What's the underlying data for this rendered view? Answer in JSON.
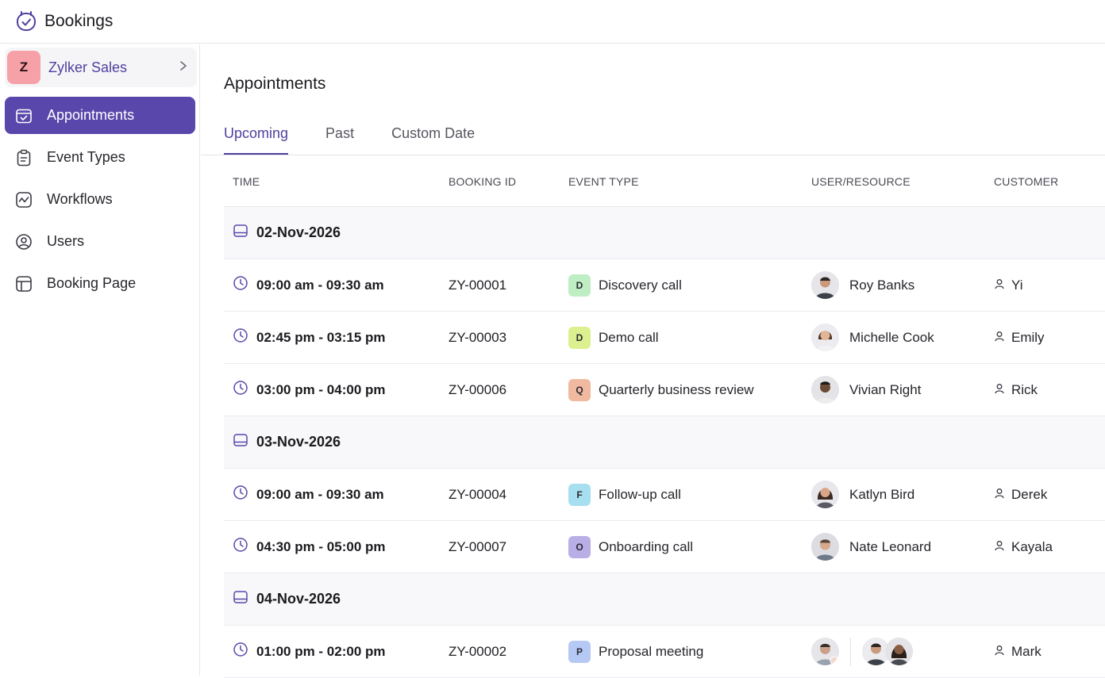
{
  "app": {
    "title": "Bookings"
  },
  "sidebar": {
    "workspace": {
      "initial": "Z",
      "name": "Zylker Sales"
    },
    "items": [
      {
        "label": "Appointments",
        "icon": "calendar-check-icon",
        "active": true
      },
      {
        "label": "Event Types",
        "icon": "clipboard-icon",
        "active": false
      },
      {
        "label": "Workflows",
        "icon": "workflow-icon",
        "active": false
      },
      {
        "label": "Users",
        "icon": "user-circle-icon",
        "active": false
      },
      {
        "label": "Booking Page",
        "icon": "layout-icon",
        "active": false
      }
    ]
  },
  "main": {
    "title": "Appointments",
    "tabs": [
      {
        "label": "Upcoming",
        "active": true
      },
      {
        "label": "Past",
        "active": false
      },
      {
        "label": "Custom Date",
        "active": false
      }
    ],
    "columns": [
      "TIME",
      "BOOKING ID",
      "EVENT TYPE",
      "USER/RESOURCE",
      "CUSTOMER"
    ],
    "groups": [
      {
        "date": "02-Nov-2026",
        "rows": [
          {
            "time": "09:00 am - 09:30 am",
            "id": "ZY-00001",
            "event_initial": "D",
            "event": "Discovery call",
            "event_color": "#bfeec4",
            "user": "Roy Banks",
            "customer": "Yi"
          },
          {
            "time": "02:45 pm - 03:15 pm",
            "id": "ZY-00003",
            "event_initial": "D",
            "event": "Demo call",
            "event_color": "#dcf08f",
            "user": "Michelle Cook",
            "customer": "Emily"
          },
          {
            "time": "03:00 pm - 04:00 pm",
            "id": "ZY-00006",
            "event_initial": "Q",
            "event": "Quarterly business review",
            "event_color": "#f1b9a0",
            "user": "Vivian Right",
            "customer": "Rick"
          }
        ]
      },
      {
        "date": "03-Nov-2026",
        "rows": [
          {
            "time": "09:00 am - 09:30 am",
            "id": "ZY-00004",
            "event_initial": "F",
            "event": "Follow-up call",
            "event_color": "#a6dff0",
            "user": "Katlyn Bird",
            "customer": "Derek"
          },
          {
            "time": "04:30 pm - 05:00 pm",
            "id": "ZY-00007",
            "event_initial": "O",
            "event": "Onboarding call",
            "event_color": "#b9aee6",
            "user": "Nate Leonard",
            "customer": "Kayala"
          }
        ]
      },
      {
        "date": "04-Nov-2026",
        "rows": [
          {
            "time": "01:00 pm - 02:00 pm",
            "id": "ZY-00002",
            "event_initial": "P",
            "event": "Proposal meeting",
            "event_color": "#b6c9f4",
            "user": "",
            "customer": "Mark",
            "multi": true
          }
        ]
      }
    ]
  },
  "colors": {
    "accent": "#5a47ab",
    "accent_text": "#4f3f9e",
    "workspace_avatar": "#f6a1a8"
  }
}
